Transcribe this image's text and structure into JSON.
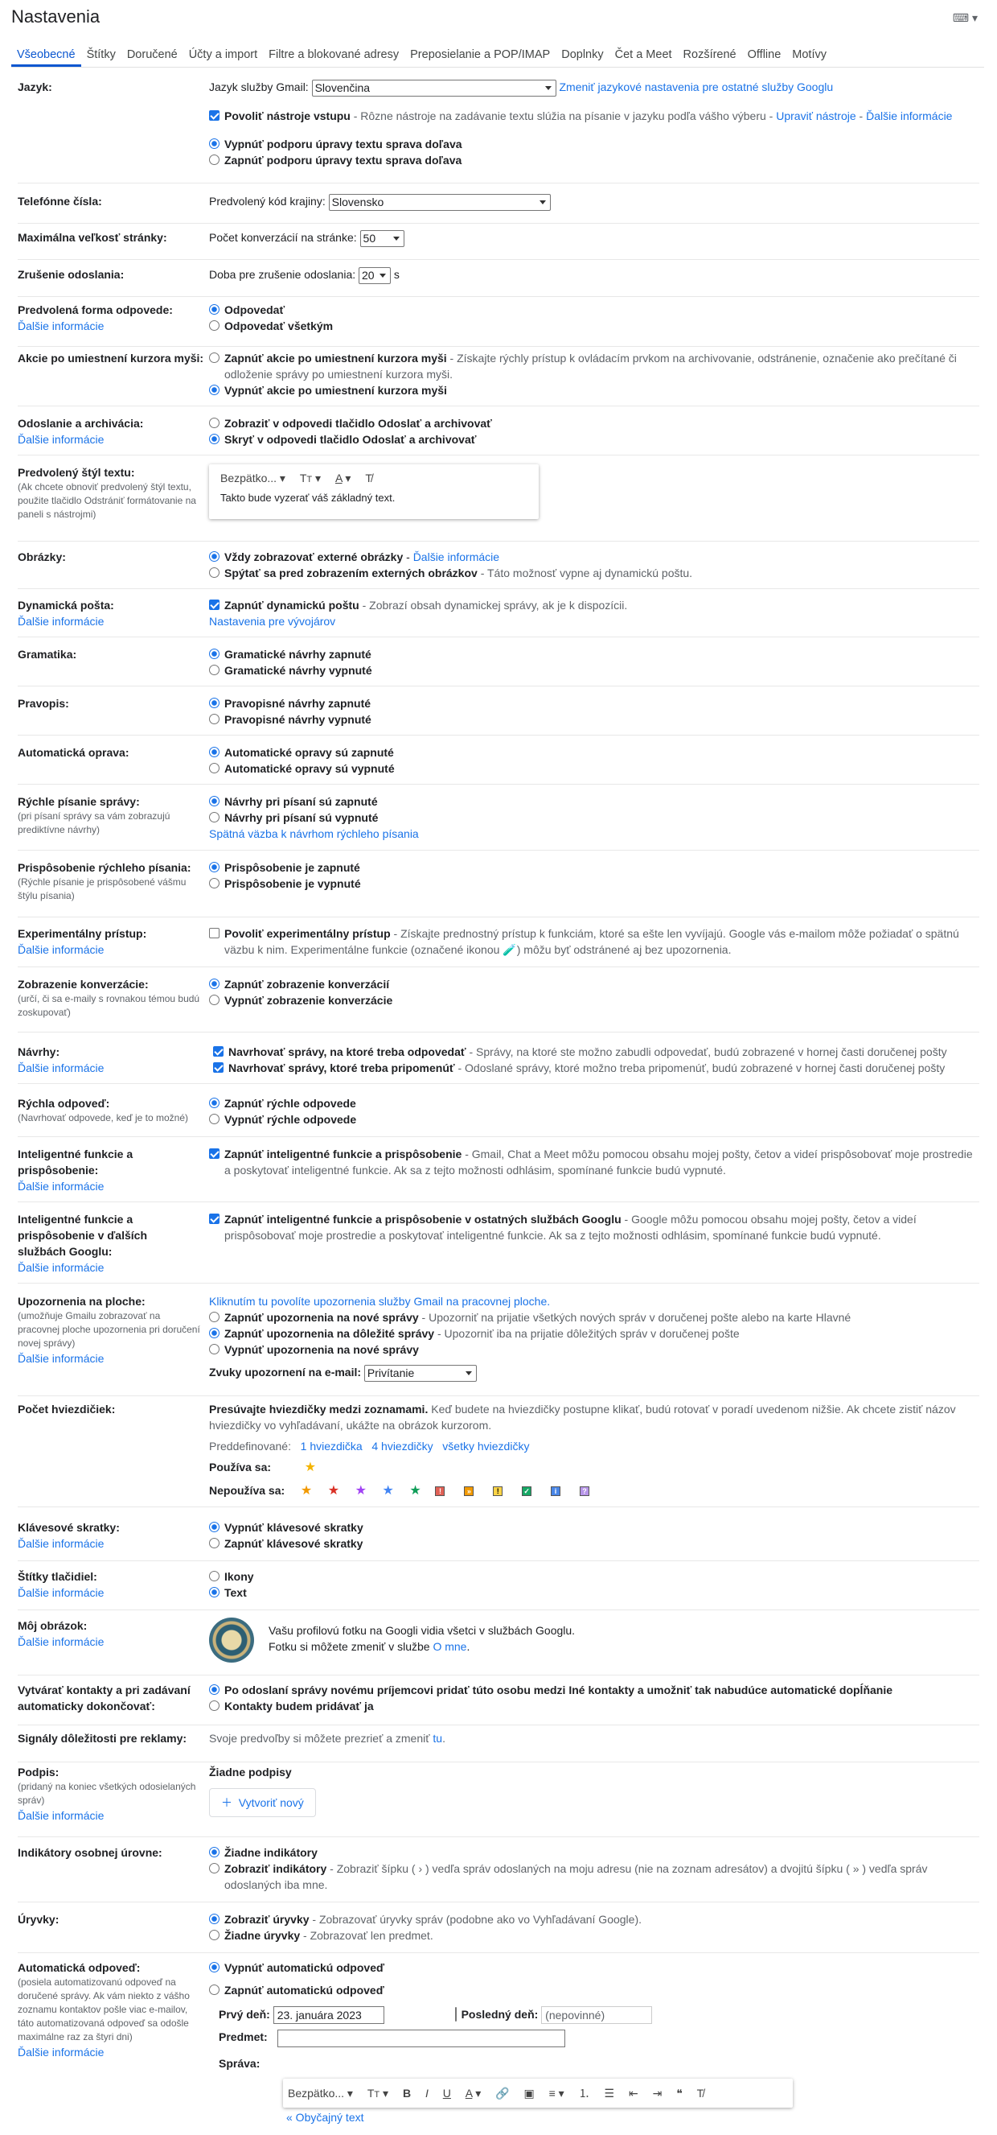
{
  "title": "Nastavenia",
  "keyboard": "⌨ ▾",
  "tabs": [
    "Všeobecné",
    "Štítky",
    "Doručené",
    "Účty a import",
    "Filtre a blokované adresy",
    "Preposielanie a POP/IMAP",
    "Doplnky",
    "Čet a Meet",
    "Rozšírené",
    "Offline",
    "Motívy"
  ],
  "lang": {
    "label": "Jazyk:",
    "gmail_lang": "Jazyk služby Gmail:",
    "selected": "Slovenčina",
    "change_link": "Zmeniť jazykové nastavenia pre ostatné služby Googlu",
    "input_tools_b": "Povoliť nástroje vstupu",
    "input_tools_t": " - Rôzne nástroje na zadávanie textu slúžia na písanie v jazyku podľa vášho výberu - ",
    "edit_tools": "Upraviť nástroje",
    "dash": " - ",
    "more": "Ďalšie informácie",
    "rtl_off": "Vypnúť podporu úpravy textu sprava doľava",
    "rtl_on": "Zapnúť podporu úpravy textu sprava doľava"
  },
  "phone": {
    "label": "Telefónne čísla:",
    "text": "Predvolený kód krajiny:",
    "selected": "Slovensko"
  },
  "page_size": {
    "label": "Maximálna veľkosť stránky:",
    "text": "Počet konverzácií na stránke:",
    "selected": "50"
  },
  "undo": {
    "label": "Zrušenie odoslania:",
    "text": "Doba pre zrušenie odoslania:",
    "selected": "20",
    "unit": "s"
  },
  "reply": {
    "label": "Predvolená forma odpovede:",
    "more": "Ďalšie informácie",
    "opt1": "Odpovedať",
    "opt2": "Odpovedať všetkým"
  },
  "hover": {
    "label": "Akcie po umiestnení kurzora myši:",
    "opt1_b": "Zapnúť akcie po umiestnení kurzora myši",
    "opt1_t": " - Získajte rýchly prístup k ovládacím prvkom na archivovanie, odstránenie, označenie ako prečítané či odloženie správy po umiestnení kurzora myši.",
    "opt2": "Vypnúť akcie po umiestnení kurzora myši"
  },
  "send_archive": {
    "label": "Odoslanie a archivácia:",
    "more": "Ďalšie informácie",
    "opt1": "Zobraziť v odpovedi tlačidlo Odoslať a archivovať",
    "opt2": "Skryť v odpovedi tlačidlo Odoslať a archivovať"
  },
  "text_style": {
    "label": "Predvolený štýl textu:",
    "sub": "(Ak chcete obnoviť predvolený štýl textu, použite tlačidlo Odstrániť formátovanie na paneli s nástrojmi)",
    "font": "Bezpätko...",
    "preview": "Takto bude vyzerať váš základný text."
  },
  "images": {
    "label": "Obrázky:",
    "opt1_b": "Vždy zobrazovať externé obrázky",
    "opt1_link": "Ďalšie informácie",
    "opt2_b": "Spýtať sa pred zobrazením externých obrázkov",
    "opt2_t": " - Táto možnosť vypne aj dynamickú poštu."
  },
  "dynamic": {
    "label": "Dynamická pošta:",
    "more": "Ďalšie informácie",
    "opt_b": "Zapnúť dynamickú poštu",
    "opt_t": " - Zobrazí obsah dynamickej správy, ak je k dispozícii.",
    "dev": "Nastavenia pre vývojárov"
  },
  "grammar": {
    "label": "Gramatika:",
    "opt1": "Gramatické návrhy zapnuté",
    "opt2": "Gramatické návrhy vypnuté"
  },
  "spelling": {
    "label": "Pravopis:",
    "opt1": "Pravopisné návrhy zapnuté",
    "opt2": "Pravopisné návrhy vypnuté"
  },
  "autocorrect": {
    "label": "Automatická oprava:",
    "opt1": "Automatické opravy sú zapnuté",
    "opt2": "Automatické opravy sú vypnuté"
  },
  "smart_compose": {
    "label": "Rýchle písanie správy:",
    "sub": "(pri písaní správy sa vám zobrazujú prediktívne návrhy)",
    "opt1": "Návrhy pri písaní sú zapnuté",
    "opt2": "Návrhy pri písaní sú vypnuté",
    "feedback": "Spätná väzba k návrhom rýchleho písania"
  },
  "personalization": {
    "label": "Prispôsobenie rýchleho písania:",
    "sub": "(Rýchle písanie je prispôsobené vášmu štýlu písania)",
    "opt1": "Prispôsobenie je zapnuté",
    "opt2": "Prispôsobenie je vypnuté"
  },
  "experimental": {
    "label": "Experimentálny prístup:",
    "more": "Ďalšie informácie",
    "opt_b": "Povoliť experimentálny prístup",
    "opt_t": " - Získajte prednostný prístup k funkciám, ktoré sa ešte len vyvíjajú. Google vás e-mailom môže požiadať o spätnú väzbu k nim. Experimentálne funkcie (označené ikonou 🧪) môžu byť odstránené aj bez upozornenia."
  },
  "conversation": {
    "label": "Zobrazenie konverzácie:",
    "sub": "(určí, či sa e-maily s rovnakou témou budú zoskupovať)",
    "opt1": "Zapnúť zobrazenie konverzácií",
    "opt2": "Vypnúť zobrazenie konverzácie"
  },
  "nudges": {
    "label": "Návrhy:",
    "more": "Ďalšie informácie",
    "opt1_b": "Navrhovať správy, na ktoré treba odpovedať",
    "opt1_t": " - Správy, na ktoré ste možno zabudli odpovedať, budú zobrazené v hornej časti doručenej pošty",
    "opt2_b": "Navrhovať správy, ktoré treba pripomenúť",
    "opt2_t": " - Odoslané správy, ktoré možno treba pripomenúť, budú zobrazené v hornej časti doručenej pošty"
  },
  "smart_reply": {
    "label": "Rýchla odpoveď:",
    "sub": "(Navrhovať odpovede, keď je to možné)",
    "opt1": "Zapnúť rýchle odpovede",
    "opt2": "Vypnúť rýchle odpovede"
  },
  "smart_features": {
    "label": "Inteligentné funkcie a prispôsobenie:",
    "more": "Ďalšie informácie",
    "opt_b": "Zapnúť inteligentné funkcie a prispôsobenie",
    "opt_t": " - Gmail, Chat a Meet môžu pomocou obsahu mojej pošty, četov a videí prispôsobovať moje prostredie a poskytovať inteligentné funkcie. Ak sa z tejto možnosti odhlásim, spomínané funkcie budú vypnuté."
  },
  "smart_other": {
    "label": "Inteligentné funkcie a prispôsobenie v ďalších službách Googlu:",
    "more": "Ďalšie informácie",
    "opt_b": "Zapnúť inteligentné funkcie a prispôsobenie v ostatných službách Googlu",
    "opt_t": " - Google môžu pomocou obsahu mojej pošty, četov a videí prispôsobovať moje prostredie a poskytovať inteligentné funkcie. Ak sa z tejto možnosti odhlásim, spomínané funkcie budú vypnuté."
  },
  "desktop": {
    "label": "Upozornenia na ploche:",
    "sub": "(umožňuje Gmailu zobrazovať na pracovnej ploche upozornenia pri doručení novej správy)",
    "more": "Ďalšie informácie",
    "enable_link": "Kliknutím tu povolíte upozornenia služby Gmail na pracovnej ploche.",
    "opt1_b": "Zapnúť upozornenia na nové správy",
    "opt1_t": " - Upozorniť na prijatie všetkých nových správ v doručenej pošte alebo na karte Hlavné",
    "opt2_b": "Zapnúť upozornenia na dôležité správy",
    "opt2_t": " - Upozorniť iba na prijatie dôležitých správ v doručenej pošte",
    "opt3": "Vypnúť upozornenia na nové správy",
    "sound_label": "Zvuky upozornení na e-mail:",
    "sound": "Privítanie"
  },
  "stars": {
    "label": "Počet hviezdičiek:",
    "intro_b": "Presúvajte hviezdičky medzi zoznamami.",
    "intro_t": " Keď budete na hviezdičky postupne klikať, budú rotovať v poradí uvedenom nižšie. Ak chcete zistiť názov hviezdičky vo vyhľadávaní, ukážte na obrázok kurzorom.",
    "presets": "Preddefinované:",
    "preset1": "1 hviezdička",
    "preset2": "4 hviezdičky",
    "preset3": "všetky hviezdičky",
    "in_use": "Používa sa:",
    "not_in_use": "Nepoužíva sa:"
  },
  "shortcuts": {
    "label": "Klávesové skratky:",
    "more": "Ďalšie informácie",
    "opt1": "Vypnúť klávesové skratky",
    "opt2": "Zapnúť klávesové skratky"
  },
  "button_labels": {
    "label": "Štítky tlačidiel:",
    "more": "Ďalšie informácie",
    "opt1": "Ikony",
    "opt2": "Text"
  },
  "picture": {
    "label": "Môj obrázok:",
    "more": "Ďalšie informácie",
    "text1": "Vašu profilovú fotku na Googli vidia všetci v službách Googlu.",
    "text2": "Fotku si môžete zmeniť v službe ",
    "link": "O mne",
    "dot": "."
  },
  "contacts": {
    "label": "Vytvárať kontakty a pri zadávaní automaticky dokončovať:",
    "opt1": "Po odoslaní správy novému príjemcovi pridať túto osobu medzi Iné kontakty a umožniť tak nabudúce automatické dopĺňanie",
    "opt2": "Kontakty budem pridávať ja"
  },
  "ads": {
    "label": "Signály dôležitosti pre reklamy:",
    "text": "Svoje predvoľby si môžete prezrieť a zmeniť ",
    "link": "tu",
    "dot": "."
  },
  "signature": {
    "label": "Podpis:",
    "sub": "(pridaný na koniec všetkých odosielaných správ)",
    "more": "Ďalšie informácie",
    "none": "Žiadne podpisy",
    "create": "Vytvoriť nový"
  },
  "indicators": {
    "label": "Indikátory osobnej úrovne:",
    "opt1": "Žiadne indikátory",
    "opt2_b": "Zobraziť indikátory",
    "opt2_t": " - Zobraziť šípku ( › ) vedľa správ odoslaných na moju adresu (nie na zoznam adresátov) a dvojitú šípku ( » ) vedľa správ odoslaných iba mne."
  },
  "snippets": {
    "label": "Úryvky:",
    "opt1_b": "Zobraziť úryvky",
    "opt1_t": " - Zobrazovať úryvky správ (podobne ako vo Vyhľadávaní Google).",
    "opt2_b": "Žiadne úryvky",
    "opt2_t": " - Zobrazovať len predmet."
  },
  "vacation": {
    "label": "Automatická odpoveď:",
    "sub": "(posiela automatizovanú odpoveď na doručené správy. Ak vám niekto z vášho zoznamu kontaktov pošle viac e-mailov, táto automatizovaná odpoveď sa odošle maximálne raz za štyri dni)",
    "more": "Ďalšie informácie",
    "opt1": "Vypnúť automatickú odpoveď",
    "opt2": "Zapnúť automatickú odpoveď",
    "first_day": "Prvý deň:",
    "first_val": "23. januára 2023",
    "last_day": "Posledný deň:",
    "last_ph": "(nepovinné)",
    "subject": "Predmet:",
    "message": "Správa:",
    "font": "Bezpätko...",
    "plain": "« Obyčajný text"
  }
}
